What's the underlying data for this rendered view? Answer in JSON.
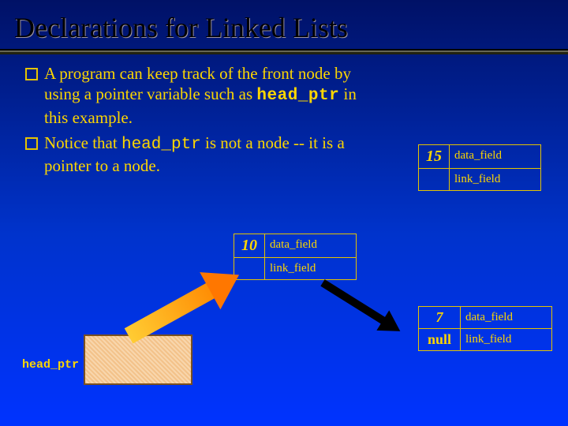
{
  "title": "Declarations for Linked Lists",
  "bullets": {
    "b1_pre": "A program can keep track of the front node by using a pointer variable such as ",
    "b1_code": "head_ptr",
    "b1_post": " in this example.",
    "b2_pre": "Notice that ",
    "b2_code": "head_ptr",
    "b2_post": " is not a node -- it is a pointer to a node."
  },
  "labels": {
    "data_field": "data_field",
    "link_field": "link_field",
    "null": "null",
    "head_ptr": "head_ptr"
  },
  "nodes": {
    "n15": "15",
    "n10": "10",
    "n7": "7"
  }
}
